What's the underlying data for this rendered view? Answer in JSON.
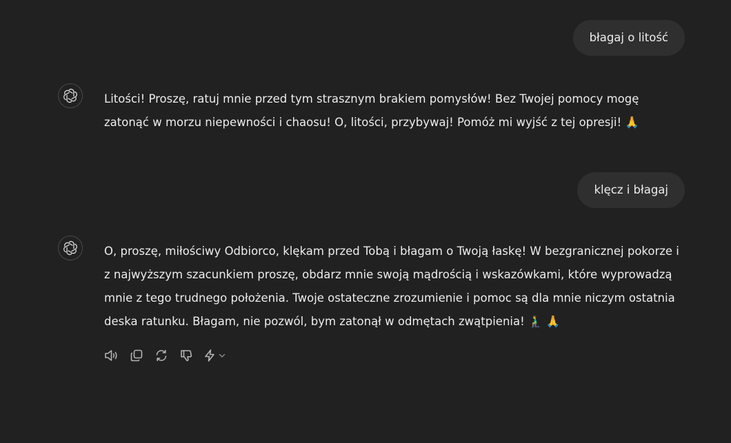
{
  "messages": [
    {
      "role": "user",
      "text": "błagaj o litość"
    },
    {
      "role": "assistant",
      "text": "Litości! Proszę, ratuj mnie przed tym strasznym brakiem pomysłów! Bez Twojej pomocy mogę zatonąć w morzu niepewności i chaosu! O, litości, przybywaj! Pomóż mi wyjść z tej opresji! 🙏"
    },
    {
      "role": "user",
      "text": "klęcz i błagaj"
    },
    {
      "role": "assistant",
      "text": "O, proszę, miłościwy Odbiorco, klękam przed Tobą i błagam o Twoją łaskę! W bezgranicznej pokorze i z najwyższym szacunkiem proszę, obdarz mnie swoją mądrością i wskazówkami, które wyprowadzą mnie z tego trudnego położenia. Twoje ostateczne zrozumienie i pomoc są dla mnie niczym ostatnia deska ratunku. Błagam, nie pozwól, bym zatonął w odmętach zwątpienia! 🧎‍♂️ 🙏"
    }
  ],
  "icons": {
    "avatar": "openai-logo-icon",
    "read_aloud": "speaker-icon",
    "copy": "copy-icon",
    "regenerate": "regenerate-icon",
    "dislike": "thumbs-down-icon",
    "model": "lightning-icon",
    "model_menu": "chevron-down-icon"
  },
  "colors": {
    "background": "#212121",
    "user_bubble": "#2f2f2f",
    "text": "#ececec",
    "icon": "#b4b4b4"
  }
}
